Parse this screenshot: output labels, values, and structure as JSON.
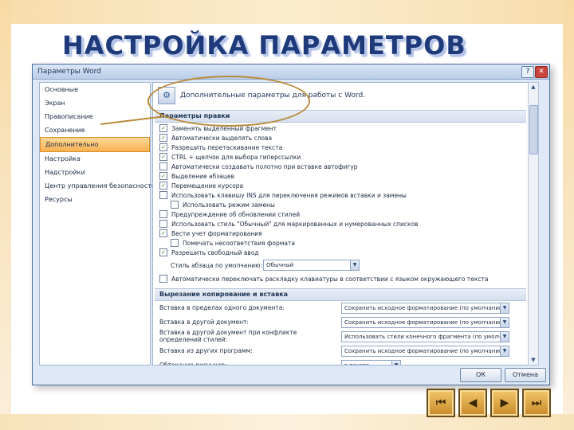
{
  "slide": {
    "title": "НАСТРОЙКА ПАРАМЕТРОВ"
  },
  "dialog": {
    "title": "Параметры Word",
    "help_btn": "?",
    "close_btn": "✕",
    "nav": [
      "Основные",
      "Экран",
      "Правописание",
      "Сохранение",
      "Дополнительно",
      "Настройка",
      "Надстройки",
      "Центр управления безопасностью",
      "Ресурсы"
    ],
    "active_nav_index": 4,
    "header": "Дополнительные параметры для работы с Word.",
    "sections": {
      "edit": "Параметры правки",
      "cut": "Вырезание копирование и вставка"
    },
    "edit_options": [
      {
        "label": "Заменять выделенный фрагмент",
        "checked": true
      },
      {
        "label": "Автоматически выделять слова",
        "checked": true
      },
      {
        "label": "Разрешить перетаскивание текста",
        "checked": true
      },
      {
        "label": "CTRL + щелчок для выбора гиперссылки",
        "checked": true
      },
      {
        "label": "Автоматически создавать полотно при вставке автофигур",
        "checked": false
      },
      {
        "label": "Выделение абзацев",
        "checked": true
      },
      {
        "label": "Перемещение курсора",
        "checked": true
      },
      {
        "label": "Использовать клавишу INS для переключения режимов вставки и замены",
        "checked": false
      },
      {
        "label": "Использовать режим замены",
        "checked": false,
        "indent": true
      },
      {
        "label": "Предупреждение об обновлении стилей",
        "checked": false
      },
      {
        "label": "Использовать стиль \"Обычный\" для маркированных и нумерованных списков",
        "checked": false
      },
      {
        "label": "Вести учет форматирования",
        "checked": true
      },
      {
        "label": "Помечать несоответствия формата",
        "checked": false,
        "indent": true
      },
      {
        "label": "Разрешить свободный ввод",
        "checked": true
      }
    ],
    "style_label": "Стиль абзаца по умолчанию:",
    "style_value": "Обычный",
    "auto_switch": "Автоматически переключать раскладку клавиатуры в соответствии с языком окружающего текста",
    "paste_rows": [
      {
        "label": "Вставка в пределах одного документа:",
        "value": "Сохранить исходное форматирование (по умолчанию)"
      },
      {
        "label": "Вставка в другой документ:",
        "value": "Сохранить исходное форматирование (по умолчанию)"
      },
      {
        "label": "Вставка в другой документ при конфликте определений стилей:",
        "value": "Использовать стили конечного фрагмента (по умолчанию)"
      },
      {
        "label": "Вставка из других программ:",
        "value": "Сохранить исходное форматирование (по умолчанию)"
      },
      {
        "label": "Обтекание рисунков:",
        "value": "в тексте"
      }
    ],
    "ok": "ОК",
    "cancel": "Отмена"
  },
  "navigation_buttons": [
    "first",
    "previous",
    "next",
    "last"
  ],
  "colors": {
    "title": "#1f3a7a",
    "accent": "#f8b150",
    "callout": "#b88a3a"
  }
}
